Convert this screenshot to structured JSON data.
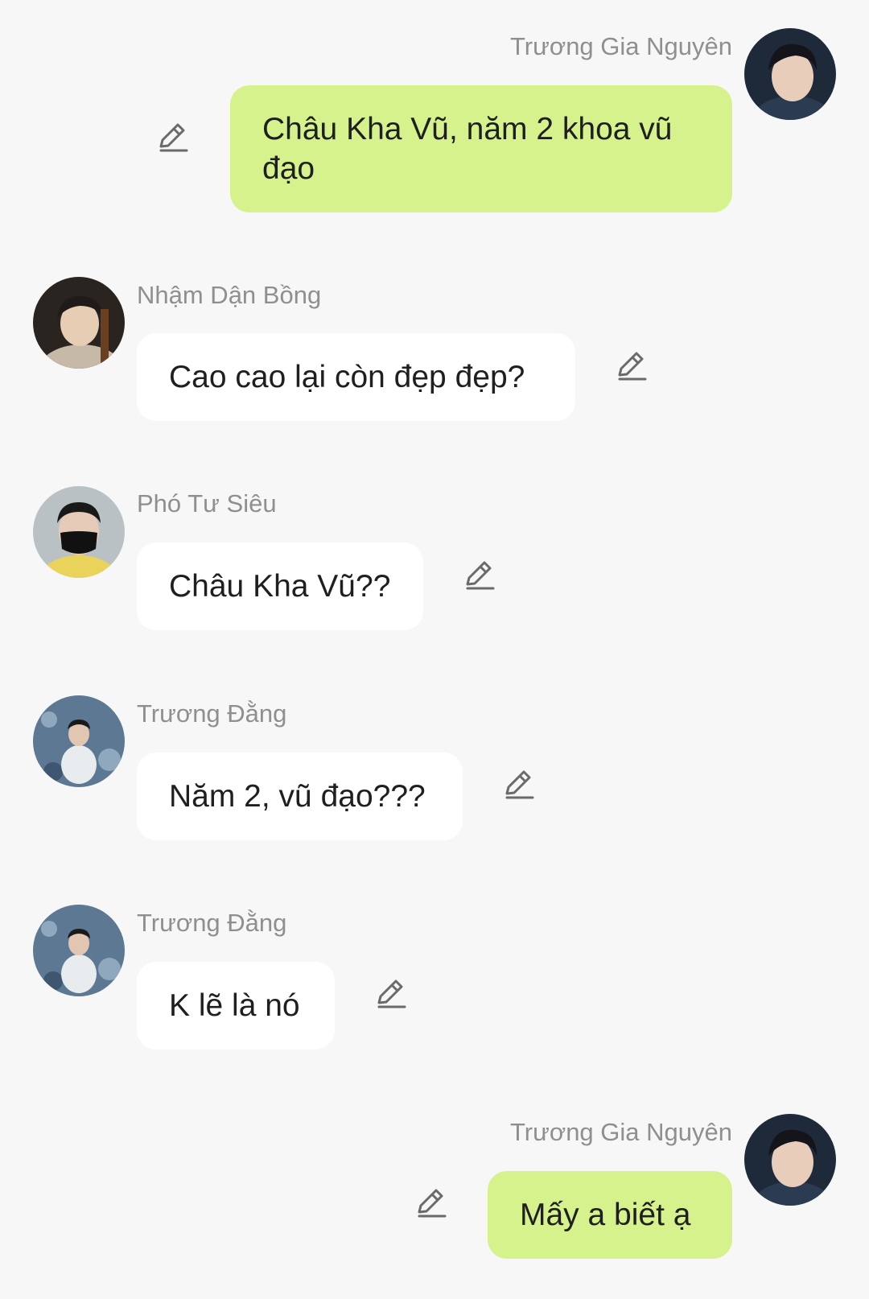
{
  "messages": [
    {
      "sender": "Trương Gia Nguyên",
      "text": "Châu Kha Vũ, năm 2 khoa vũ đạo",
      "side": "right",
      "avatar": "avatar-dark-jacket-boy"
    },
    {
      "sender": "Nhậm Dận Bồng",
      "text": "Cao cao lại còn đẹp đẹp?",
      "side": "left",
      "avatar": "avatar-guitar-player"
    },
    {
      "sender": "Phó Tư Siêu",
      "text": "Châu Kha Vũ??",
      "side": "left",
      "avatar": "avatar-black-mask"
    },
    {
      "sender": "Trương Đằng",
      "text": "Năm 2, vũ đạo???",
      "side": "left",
      "avatar": "avatar-sitting-on-rocks"
    },
    {
      "sender": "Trương Đằng",
      "text": "K lẽ là nó",
      "side": "left",
      "avatar": "avatar-sitting-on-rocks"
    },
    {
      "sender": "Trương Gia Nguyên",
      "text": "Mấy a biết ạ",
      "side": "right",
      "avatar": "avatar-dark-jacket-boy"
    }
  ],
  "colors": {
    "background": "#f7f7f7",
    "incoming_bubble": "#ffffff",
    "outgoing_bubble": "#d6f28c",
    "sender_name": "#8f8f8f",
    "message_text": "#1f1f1f",
    "edit_icon": "#6a6a6a"
  },
  "icons": {
    "edit": "pencil-edit-icon"
  }
}
